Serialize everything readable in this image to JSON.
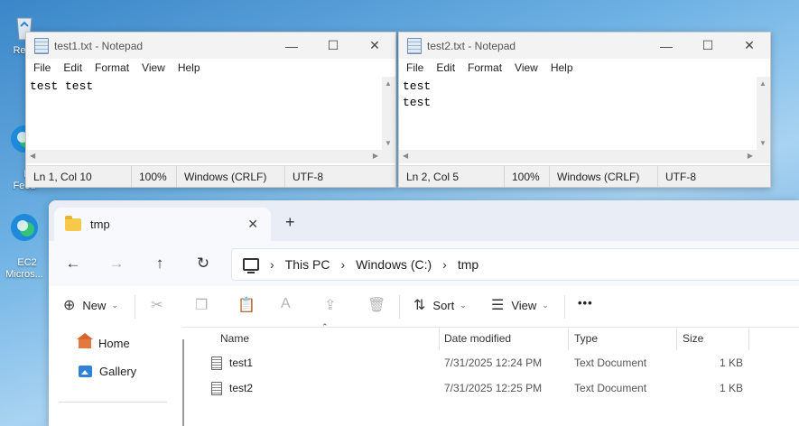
{
  "desktop": {
    "icons": [
      {
        "label": "Recy",
        "icon": "recycle-bin-icon"
      },
      {
        "label": "E\nFeed",
        "icon": "edge-icon"
      },
      {
        "label": "EC2\nMicros...",
        "icon": "edge-icon"
      }
    ]
  },
  "notepads": [
    {
      "title": "test1.txt - Notepad",
      "menu": [
        "File",
        "Edit",
        "Format",
        "View",
        "Help"
      ],
      "content": "test test",
      "status": {
        "position": "Ln 1, Col 10",
        "zoom": "100%",
        "line_ending": "Windows (CRLF)",
        "encoding": "UTF-8"
      }
    },
    {
      "title": "test2.txt - Notepad",
      "menu": [
        "File",
        "Edit",
        "Format",
        "View",
        "Help"
      ],
      "content": "test\ntest",
      "status": {
        "position": "Ln 2, Col 5",
        "zoom": "100%",
        "line_ending": "Windows (CRLF)",
        "encoding": "UTF-8"
      }
    }
  ],
  "explorer": {
    "tab": {
      "label": "tmp",
      "close": "✕"
    },
    "new_tab": "+",
    "breadcrumb": [
      "This PC",
      "Windows (C:)",
      "tmp"
    ],
    "commands": {
      "new": "New",
      "sort": "Sort",
      "view": "View",
      "more": "•••"
    },
    "nav": {
      "home": "Home",
      "gallery": "Gallery"
    },
    "columns": {
      "name": "Name",
      "date": "Date modified",
      "type": "Type",
      "size": "Size"
    },
    "files": [
      {
        "name": "test1",
        "date": "7/31/2025 12:24 PM",
        "type": "Text Document",
        "size": "1 KB"
      },
      {
        "name": "test2",
        "date": "7/31/2025 12:25 PM",
        "type": "Text Document",
        "size": "1 KB"
      }
    ]
  }
}
